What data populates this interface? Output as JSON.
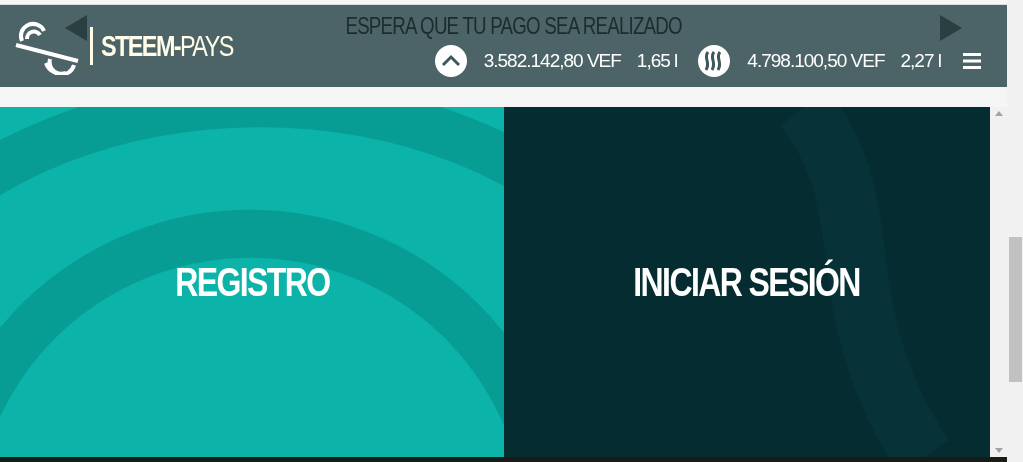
{
  "carousel": {
    "title": "ESPERA QUE TU PAGO SEA REALIZADO"
  },
  "header": {
    "brand": "**STEEM-**PAYS",
    "rates": [
      {
        "kind": "up",
        "price": "3.582.142,80 VEF",
        "change": "1,65 l"
      },
      {
        "kind": "steem",
        "price": "4.798.100,50 VEF",
        "change": "2,27 l"
      }
    ]
  },
  "actions": [
    {
      "kind": "primary",
      "label": "REGISTRO"
    },
    {
      "kind": "secondary",
      "label": "INICIAR SESIÓN"
    }
  ]
}
